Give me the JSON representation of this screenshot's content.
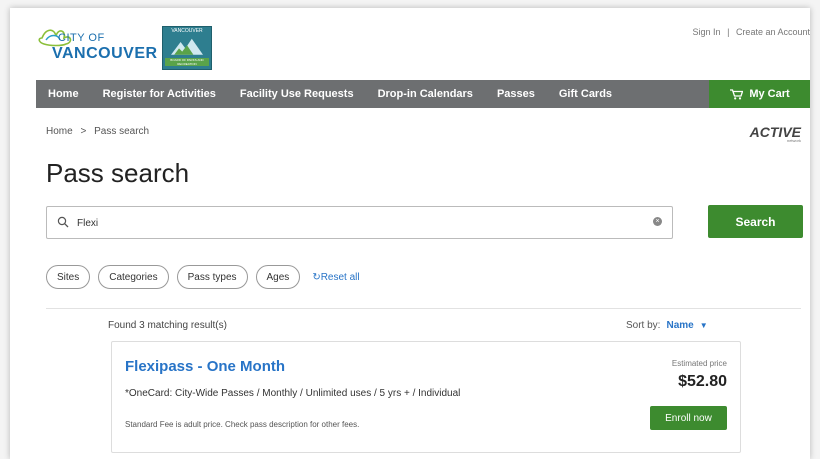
{
  "header": {
    "logo_line1": "CITY OF",
    "logo_line2": "VANCOUVER",
    "parks_badge_top": "VANCOUVER",
    "parks_badge_bottom": "BOARD OF PARKS AND RECREATION",
    "sign_in": "Sign In",
    "separator": "|",
    "create_account": "Create an Account"
  },
  "nav": {
    "items": [
      "Home",
      "Register for Activities",
      "Facility Use Requests",
      "Drop-in Calendars",
      "Passes",
      "Gift Cards"
    ],
    "cart_label": "My Cart"
  },
  "breadcrumb": {
    "home": "Home",
    "sep": ">",
    "current": "Pass search"
  },
  "active_logo": {
    "text": "ACTIVE",
    "sub": "network"
  },
  "page_title": "Pass search",
  "search": {
    "value": "Flexi",
    "button_label": "Search"
  },
  "filters": {
    "items": [
      "Sites",
      "Categories",
      "Pass types",
      "Ages"
    ],
    "reset_label": "Reset all"
  },
  "results": {
    "found_text": "Found 3 matching result(s)",
    "sort_label": "Sort by:",
    "sort_value": "Name",
    "cards": [
      {
        "title": "Flexipass - One Month",
        "description": "*OneCard: City-Wide Passes / Monthly / Unlimited uses / 5 yrs + / Individual",
        "note": "Standard Fee is adult price. Check pass description for other fees.",
        "estimated_label": "Estimated price",
        "price": "$52.80",
        "enroll_label": "Enroll now"
      }
    ]
  },
  "colors": {
    "nav_bg": "#6d6f71",
    "green": "#3d8b2f",
    "link_blue": "#2874c7"
  },
  "icons": {
    "search": "search-icon",
    "clear": "clear-icon",
    "cart": "cart-icon",
    "reset": "refresh-icon",
    "sort": "chevron-down-icon"
  }
}
